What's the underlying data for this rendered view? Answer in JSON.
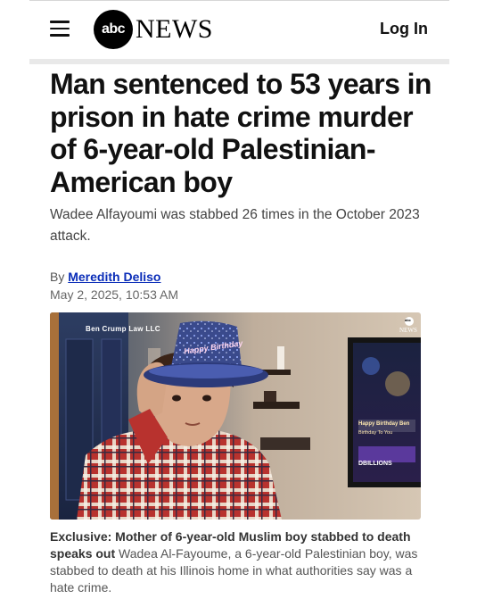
{
  "header": {
    "menu_icon": "hamburger-menu-icon",
    "logo_mark": "abc",
    "logo_word": "NEWS",
    "login_label": "Log In"
  },
  "article": {
    "headline": "Man sentenced to 53 years in prison in hate crime murder of 6-year-old Palestinian-American boy",
    "subheadline": "Wadee Alfayoumi was stabbed 26 times in the October 2023 attack.",
    "byline_prefix": "By",
    "author": "Meredith Deliso",
    "date": "May 2, 2025, 10:53 AM"
  },
  "photo": {
    "credit": "Ben Crump Law LLC",
    "watermark_mark": "abc",
    "watermark_word": "NEWS",
    "hat_text": "Happy Birthday",
    "tv_title": "Happy Birthday Ben",
    "tv_subtitle": "Birthday To You",
    "tv_brand": "DBILLIONS"
  },
  "caption": {
    "lead": "Exclusive: Mother of 6-year-old Muslim boy stabbed to death speaks out",
    "text": "Wadea Al-Fayoume, a 6-year-old Palestinian boy, was stabbed to death at his Illinois home in what authorities say was a hate crime."
  },
  "colors": {
    "link": "#0a2db8",
    "divider": "#e9e9e9",
    "text": "#111111"
  }
}
